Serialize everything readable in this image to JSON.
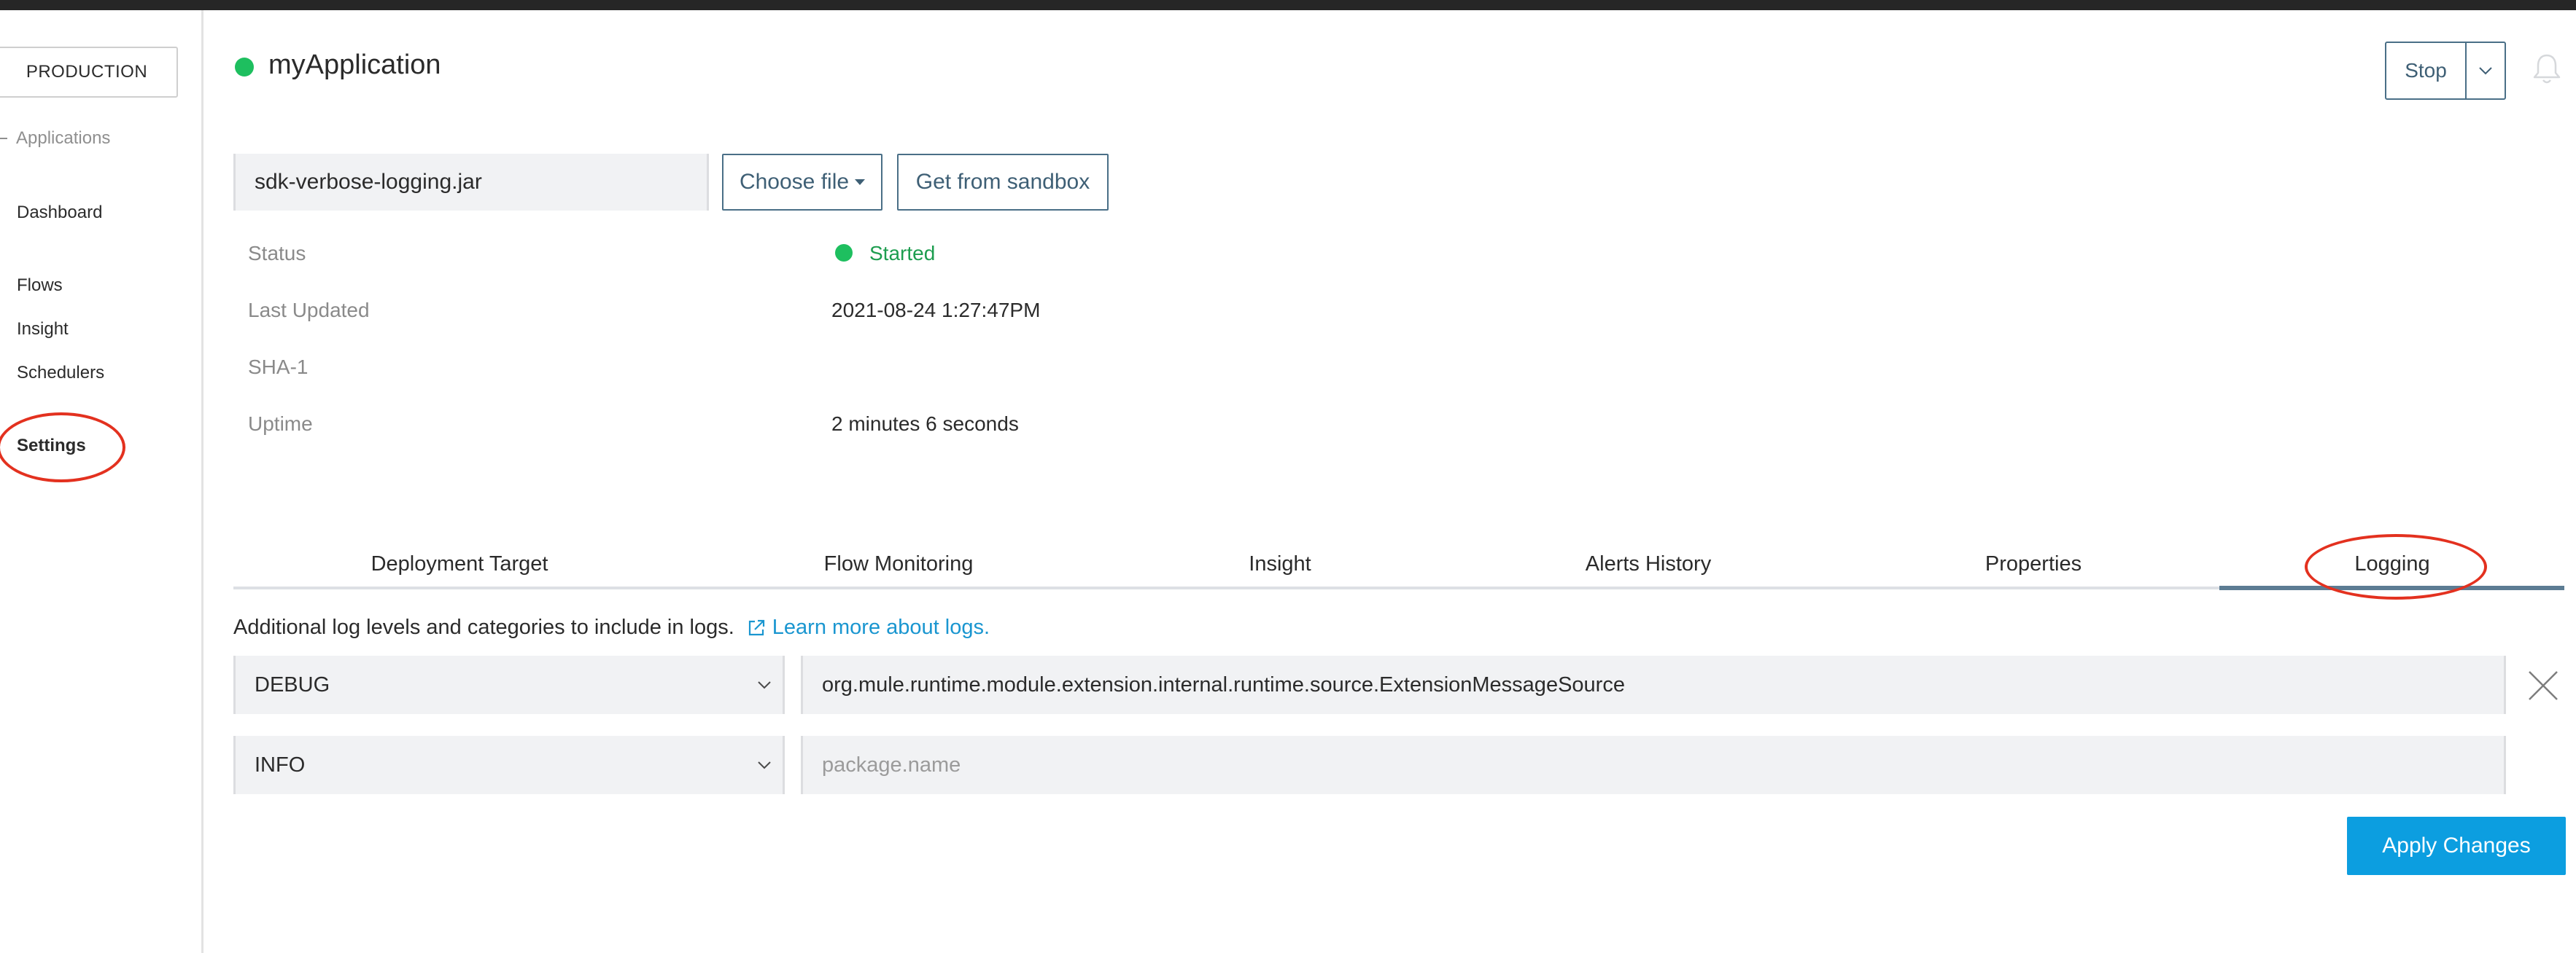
{
  "sidebar": {
    "environment": "PRODUCTION",
    "section": "Applications",
    "items": [
      {
        "label": "Dashboard"
      },
      {
        "label": "Flows"
      },
      {
        "label": "Insight"
      },
      {
        "label": "Schedulers"
      },
      {
        "label": "Settings",
        "active": true
      }
    ]
  },
  "header": {
    "app_name": "myApplication",
    "status_color": "#1ebf5f",
    "stop_label": "Stop",
    "stop_menu_icon": "chevron-down-icon",
    "notification_icon": "bell-icon"
  },
  "file": {
    "name": "sdk-verbose-logging.jar",
    "choose_label": "Choose file",
    "sandbox_label": "Get from sandbox"
  },
  "info": {
    "status_label": "Status",
    "status_value": "Started",
    "updated_label": "Last Updated",
    "updated_value": "2021-08-24 1:27:47PM",
    "sha_label": "SHA-1",
    "sha_value": "",
    "uptime_label": "Uptime",
    "uptime_value": "2 minutes 6 seconds"
  },
  "tabs": [
    {
      "label": "Deployment Target"
    },
    {
      "label": "Flow Monitoring"
    },
    {
      "label": "Insight"
    },
    {
      "label": "Alerts History"
    },
    {
      "label": "Properties"
    },
    {
      "label": "Logging",
      "active": true
    }
  ],
  "logging": {
    "description": "Additional log levels and categories to include in logs.",
    "learn_more": "Learn more about logs.",
    "rows": [
      {
        "level": "DEBUG",
        "package": "org.mule.runtime.module.extension.internal.runtime.source.ExtensionMessageSource"
      },
      {
        "level": "INFO",
        "package": "",
        "placeholder": "package.name"
      }
    ],
    "apply_label": "Apply Changes"
  },
  "colors": {
    "accent_blue": "#0c9ee0",
    "button_outline": "#4a6f87",
    "status_green": "#1ebf5f",
    "annotation_red": "#e3311f"
  }
}
